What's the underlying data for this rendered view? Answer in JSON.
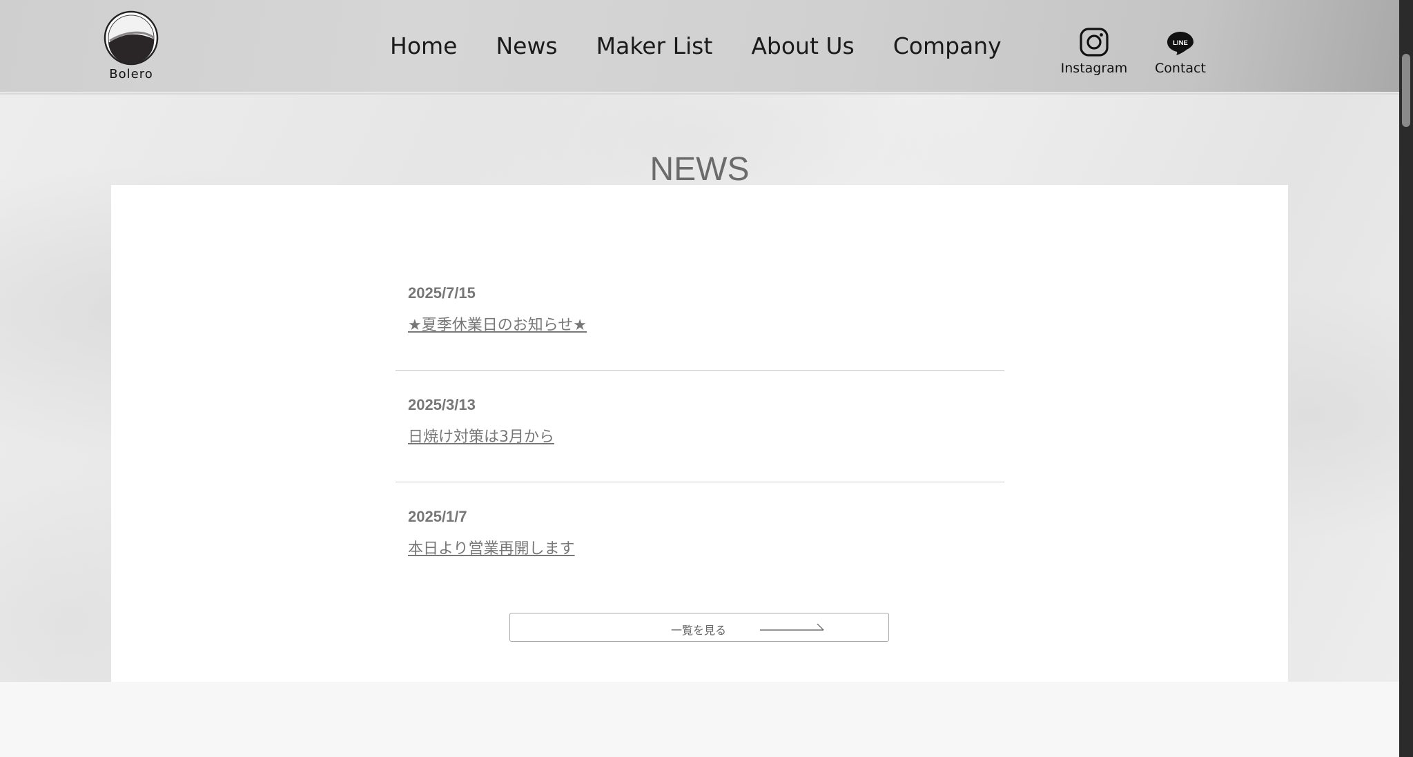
{
  "header": {
    "logo_text": "Bolero",
    "nav": [
      {
        "label": "Home"
      },
      {
        "label": "News"
      },
      {
        "label": "Maker List"
      },
      {
        "label": "About Us"
      },
      {
        "label": "Company"
      }
    ],
    "social": {
      "instagram_label": "Instagram",
      "contact_label": "Contact",
      "line_icon_text": "LINE"
    }
  },
  "news": {
    "title": "NEWS",
    "items": [
      {
        "date": "2025/7/15",
        "title": "★夏季休業日のお知らせ★"
      },
      {
        "date": "2025/3/13",
        "title": "日焼け対策は3月から"
      },
      {
        "date": "2025/1/7",
        "title": "本日より営業再開します"
      }
    ],
    "view_all_label": "一覧を見る"
  },
  "colors": {
    "header_bg": "#d0d0d0",
    "panel_bg": "#ffffff",
    "text_gray": "#777777",
    "title_gray": "#6b6b6b",
    "nav_text": "#1a1a1a",
    "divider": "#c9c9c9"
  }
}
